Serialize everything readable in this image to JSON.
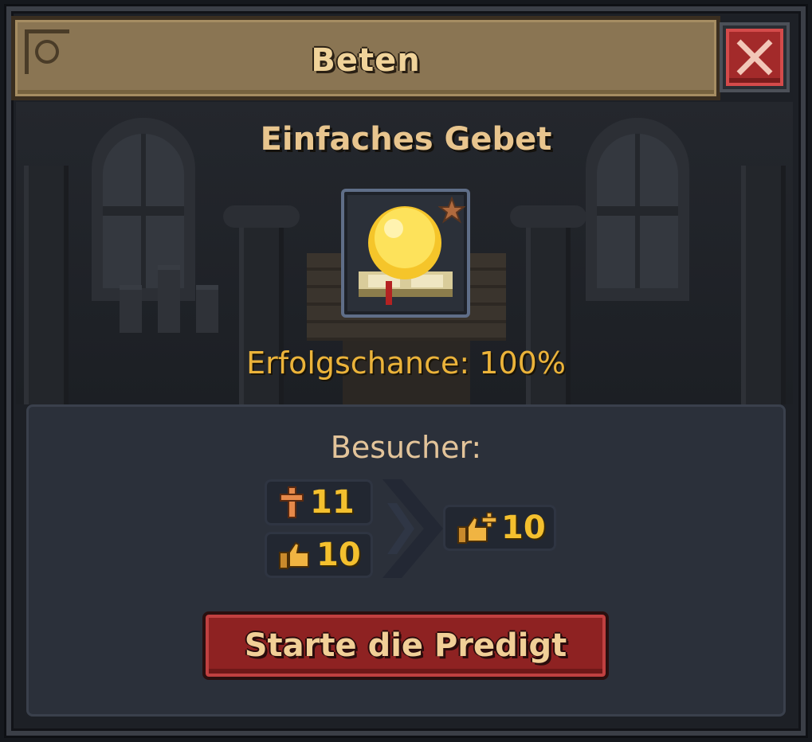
{
  "dialog": {
    "title": "Beten",
    "close_icon": "close-icon"
  },
  "prayer": {
    "name": "Einfaches Gebet",
    "icon": "prayer-orb-book-icon",
    "badge_icon": "star-icon",
    "success_chance": "Erfolgschance: 100%"
  },
  "visitors": {
    "label": "Besucher:",
    "inputs": [
      {
        "icon": "cross-icon",
        "value": "11"
      },
      {
        "icon": "thumbs-up-icon",
        "value": "10"
      }
    ],
    "arrow_icon": "chevron-right-icon",
    "result": {
      "icon": "thumbs-up-plus-icon",
      "value": "10"
    }
  },
  "actions": {
    "start_label": "Starte die Predigt"
  },
  "colors": {
    "title_bar": "#8a7553",
    "panel": "#2b303a",
    "accent_gold": "#f4c02e",
    "chance_text": "#ebb33a",
    "button_red": "#8e2222"
  }
}
